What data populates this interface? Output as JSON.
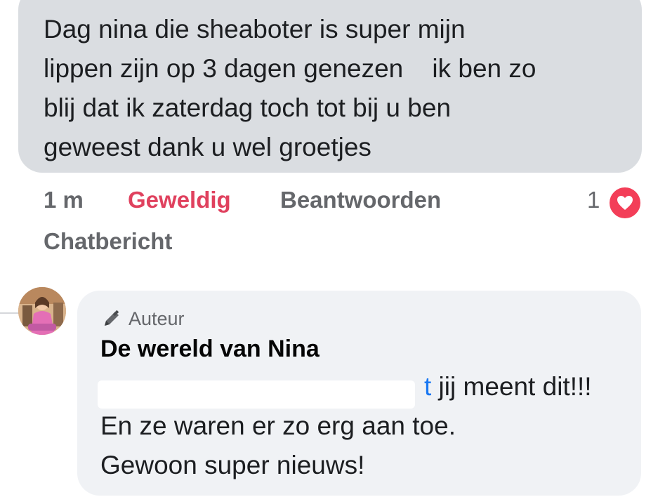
{
  "comment": {
    "lines": [
      "Dag nina die sheaboter is super mijn",
      "lippen zijn op 3 dagen genezen    ik ben zo",
      "blij dat ik zaterdag toch tot bij u ben",
      "geweest dank u wel groetjes"
    ],
    "time": "1 m",
    "reaction_label": "Geweldig",
    "reply_label": "Beantwoorden",
    "chat_label": "Chatbericht",
    "reaction_count": "1",
    "reaction_icon": "heart-icon",
    "reaction_color": "#f33e58"
  },
  "reply": {
    "badge": "Auteur",
    "author": "De wereld van Nina",
    "mention_suffix": "t",
    "line1_rest": " jij meent dit!!!",
    "line2": "En ze waren er zo erg aan toe.",
    "line3": "Gewoon super nieuws!",
    "mention_color": "#1877f2"
  }
}
